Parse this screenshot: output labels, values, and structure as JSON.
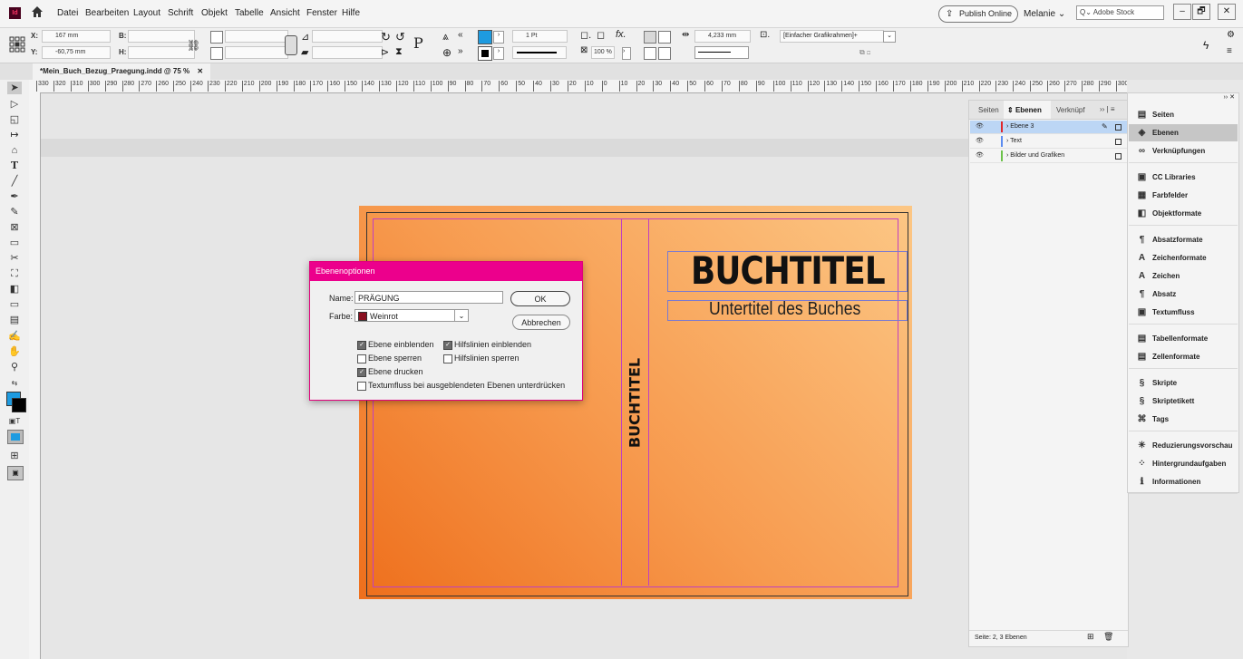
{
  "menubar": {
    "app_logo": "Id",
    "items": [
      "Datei",
      "Bearbeiten",
      "Layout",
      "Schrift",
      "Objekt",
      "Tabelle",
      "Ansicht",
      "Fenster",
      "Hilfe"
    ],
    "publish_label": "Publish Online",
    "user": "Melanie",
    "stock_search_placeholder": "Adobe Stock",
    "win_min": "–",
    "win_restore": "🗗",
    "win_close": "✕"
  },
  "control_bar": {
    "x_label": "X:",
    "x_value": "167 mm",
    "y_label": "Y:",
    "y_value": "-60,75 mm",
    "w_label": "B:",
    "h_label": "H:",
    "stroke_weight": "1 Pt",
    "zoom_value": "100 %",
    "spacing_value": "4,233 mm",
    "frame_style": "[Einfacher Grafikrahmen]+"
  },
  "document": {
    "tab_label": "*Mein_Buch_Bezug_Praegung.indd @ 75 %",
    "tab_close": "✕",
    "ruler_marks": [
      "330",
      "320",
      "310",
      "300",
      "290",
      "280",
      "270",
      "260",
      "250",
      "240",
      "230",
      "220",
      "210",
      "200",
      "190",
      "180",
      "170",
      "160",
      "150",
      "140",
      "130",
      "120",
      "110",
      "100",
      "90",
      "80",
      "70",
      "60",
      "50",
      "40",
      "30",
      "20",
      "10",
      "0",
      "10",
      "20",
      "30",
      "40",
      "50",
      "60",
      "70",
      "80",
      "90",
      "100",
      "110",
      "120",
      "130",
      "140",
      "150",
      "160",
      "170",
      "180",
      "190",
      "200",
      "210",
      "220",
      "230",
      "240",
      "250",
      "260",
      "270",
      "280",
      "290",
      "300",
      "310"
    ],
    "title": "BUCHTITEL",
    "subtitle": "Untertitel des Buches",
    "spine_title": "BUCHTITEL"
  },
  "dialog": {
    "title": "Ebenenoptionen",
    "name_label": "Name:",
    "name_value": "PRÄGUNG",
    "color_label": "Farbe:",
    "color_value": "Weinrot",
    "color_swatch": "#8a1020",
    "ok_label": "OK",
    "cancel_label": "Abbrechen",
    "options": [
      {
        "label": "Ebene einblenden",
        "checked": true
      },
      {
        "label": "Hilfslinien einblenden",
        "checked": true
      },
      {
        "label": "Ebene sperren",
        "checked": false
      },
      {
        "label": "Hilfslinien sperren",
        "checked": false
      },
      {
        "label": "Ebene drucken",
        "checked": true
      },
      {
        "label": "Textumfluss bei ausgeblendeten Ebenen unterdrücken",
        "checked": false
      }
    ]
  },
  "layers_panel": {
    "tabs": [
      "Seiten",
      "Ebenen",
      "Verknüpf"
    ],
    "layers": [
      {
        "name": "Ebene 3",
        "color": "#e0262a",
        "selected": true
      },
      {
        "name": "Text",
        "color": "#5b8cf0",
        "selected": false
      },
      {
        "name": "Bilder und Grafiken",
        "color": "#6cc24a",
        "selected": false
      }
    ],
    "status": "Seite: 2, 3 Ebenen"
  },
  "dock": {
    "groups": [
      [
        {
          "label": "Seiten",
          "icon": "▤"
        },
        {
          "label": "Ebenen",
          "icon": "◈",
          "selected": true
        },
        {
          "label": "Verknüpfungen",
          "icon": "∞"
        }
      ],
      [
        {
          "label": "CC Libraries",
          "icon": "▣"
        },
        {
          "label": "Farbfelder",
          "icon": "▦"
        },
        {
          "label": "Objektformate",
          "icon": "◧"
        }
      ],
      [
        {
          "label": "Absatzformate",
          "icon": "¶"
        },
        {
          "label": "Zeichenformate",
          "icon": "A"
        },
        {
          "label": "Zeichen",
          "icon": "A"
        },
        {
          "label": "Absatz",
          "icon": "¶"
        },
        {
          "label": "Textumfluss",
          "icon": "▣"
        }
      ],
      [
        {
          "label": "Tabellenformate",
          "icon": "▤"
        },
        {
          "label": "Zellenformate",
          "icon": "▤"
        }
      ],
      [
        {
          "label": "Skripte",
          "icon": "§"
        },
        {
          "label": "Skriptetikett",
          "icon": "§"
        },
        {
          "label": "Tags",
          "icon": "⌘"
        }
      ],
      [
        {
          "label": "Reduzierungsvorschau",
          "icon": "✳"
        },
        {
          "label": "Hintergrundaufgaben",
          "icon": "⁘"
        },
        {
          "label": "Informationen",
          "icon": "ℹ"
        }
      ]
    ]
  },
  "colors": {
    "dialog_title_bg": "#ec008c",
    "fill_swatch": "#1e9be0",
    "stroke_swatch": "#000000"
  }
}
